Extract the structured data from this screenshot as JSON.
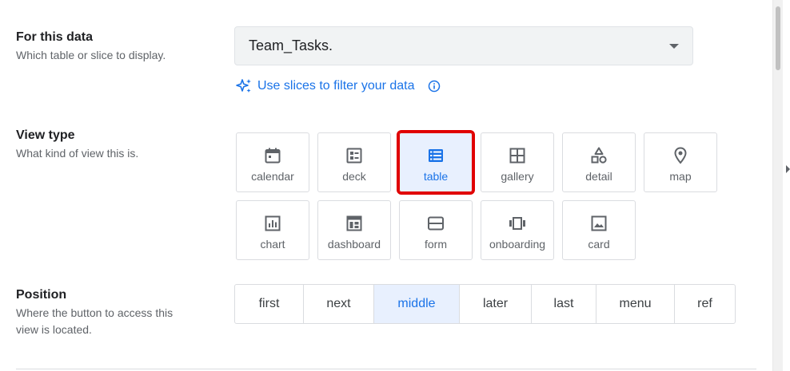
{
  "data_section": {
    "title": "For this data",
    "description": "Which table or slice to display.",
    "selected_table": "Team_Tasks.",
    "slice_link": "Use slices to filter your data"
  },
  "view_type_section": {
    "title": "View type",
    "description": "What kind of view this is.",
    "selected": "table",
    "options": [
      {
        "label": "calendar",
        "icon": "calendar-icon"
      },
      {
        "label": "deck",
        "icon": "deck-icon"
      },
      {
        "label": "table",
        "icon": "table-icon"
      },
      {
        "label": "gallery",
        "icon": "gallery-icon"
      },
      {
        "label": "detail",
        "icon": "detail-icon"
      },
      {
        "label": "map",
        "icon": "map-pin-icon"
      },
      {
        "label": "chart",
        "icon": "chart-icon"
      },
      {
        "label": "dashboard",
        "icon": "dashboard-icon"
      },
      {
        "label": "form",
        "icon": "form-icon"
      },
      {
        "label": "onboarding",
        "icon": "onboarding-icon"
      },
      {
        "label": "card",
        "icon": "card-icon"
      }
    ]
  },
  "position_section": {
    "title": "Position",
    "description_line1": "Where the button to access this",
    "description_line2": "view is located.",
    "selected": "middle",
    "options": [
      "first",
      "next",
      "middle",
      "later",
      "last",
      "menu",
      "ref"
    ]
  },
  "colors": {
    "accent": "#1a73e8",
    "selected_bg": "#e8f0fe",
    "highlight_border": "#e00000",
    "icon_gray": "#5f6368"
  }
}
